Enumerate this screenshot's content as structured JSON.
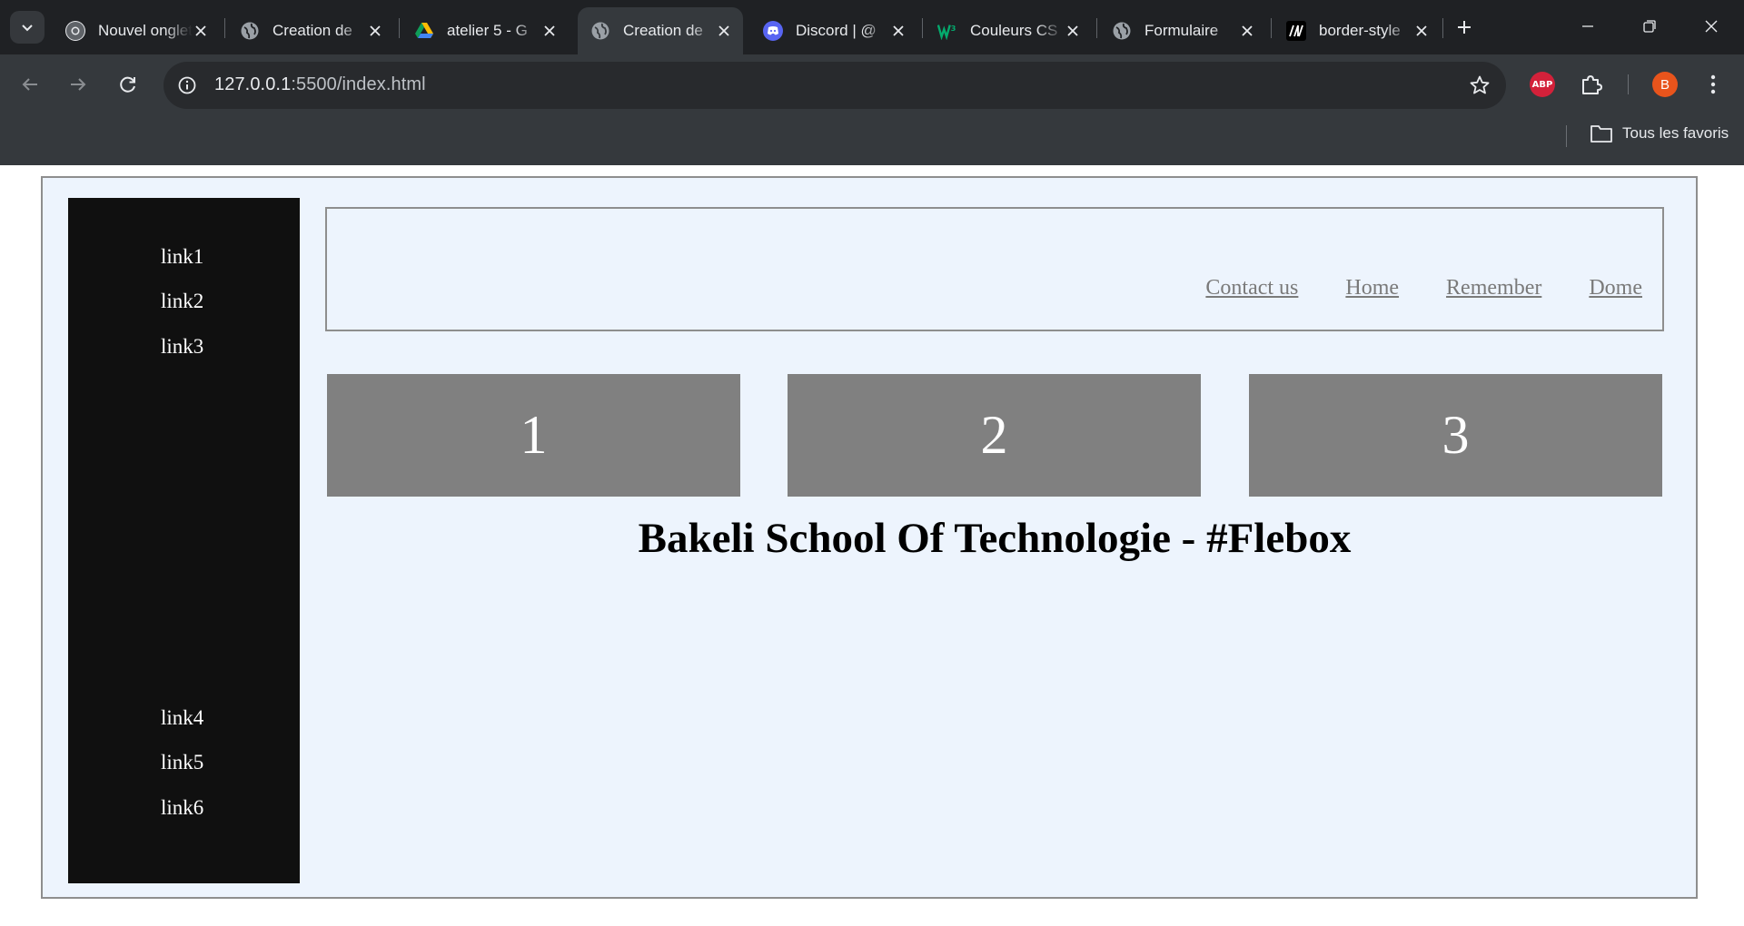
{
  "browser": {
    "tabs": [
      {
        "title": "Nouvel onglet",
        "favicon": "chrome-icon",
        "active": false
      },
      {
        "title": "Creation de",
        "favicon": "globe-icon",
        "active": false
      },
      {
        "title": "atelier 5 - G",
        "favicon": "drive-icon",
        "active": false
      },
      {
        "title": "Creation de",
        "favicon": "globe-icon",
        "active": true
      },
      {
        "title": "Discord | @",
        "favicon": "discord-icon",
        "active": false
      },
      {
        "title": "Couleurs CS",
        "favicon": "w3-icon",
        "active": false
      },
      {
        "title": "Formulaire",
        "favicon": "globe-icon",
        "active": false
      },
      {
        "title": "border-style",
        "favicon": "mdn-icon",
        "active": false
      }
    ],
    "url_host": "127.0.0.1",
    "url_rest": ":5500/index.html",
    "abp_label": "ABP",
    "profile_initial": "B",
    "bookmarks_all": "Tous les favoris"
  },
  "page": {
    "sidebar_links": [
      "link1",
      "link2",
      "link3",
      "link4",
      "link5",
      "link6"
    ],
    "header_nav": [
      "Contact us",
      "Home",
      "Remember",
      "Dome"
    ],
    "boxes": [
      "1",
      "2",
      "3"
    ],
    "heading": "Bakeli School Of Technologie - #Flebox"
  },
  "colors": {
    "page_background": "#edf4fd",
    "sidebar_background": "#101010",
    "box_background": "#808080",
    "nav_link": "#7a7a7a"
  }
}
